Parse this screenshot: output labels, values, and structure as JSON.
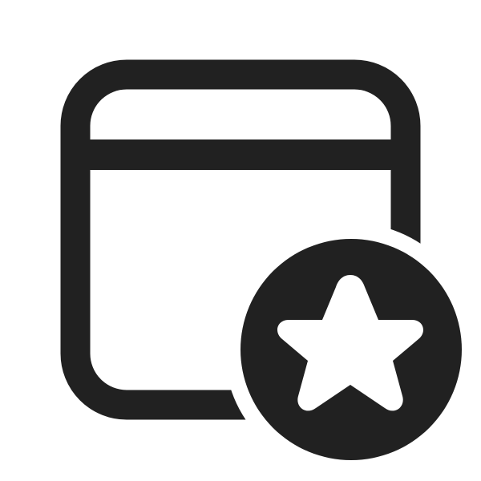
{
  "icon": {
    "name": "calendar-star-icon",
    "foreground_color": "#212121",
    "background_color": "#ffffff"
  }
}
